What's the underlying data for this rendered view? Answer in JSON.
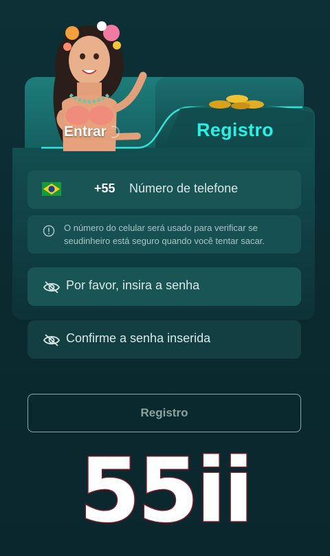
{
  "tabs": {
    "login_label": "Entrar",
    "register_label": "Registro"
  },
  "phone": {
    "flag": "brazil-flag-icon",
    "country_code": "+55",
    "placeholder": "Número de telefone"
  },
  "notice": {
    "icon": "info-icon",
    "text": "O número do celular será usado para verificar se seudinheiro está seguro quando você tentar sacar."
  },
  "password": {
    "icon": "eye-off-icon",
    "placeholder": "Por favor, insira a senha"
  },
  "confirm_password": {
    "icon": "eye-off-icon",
    "placeholder": "Confirme a senha inserida"
  },
  "submit_label": "Registro",
  "brand_text": "55ii",
  "colors": {
    "background": "#0b2a30",
    "accent": "#29f0e2",
    "field": "#1a5556",
    "brand_stroke": "#7a1a26"
  }
}
